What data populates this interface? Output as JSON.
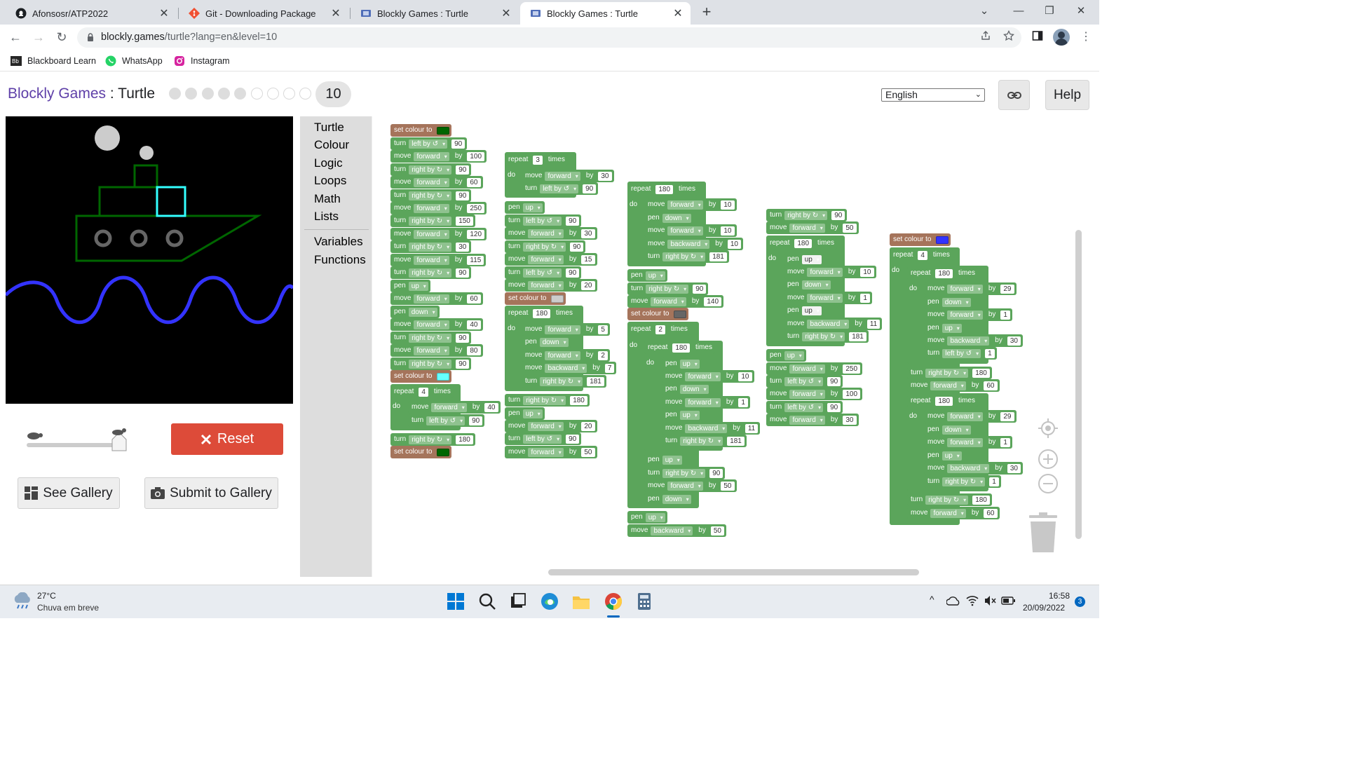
{
  "browser": {
    "tabs": [
      {
        "title": "Afonsosr/ATP2022",
        "icon": "github-icon"
      },
      {
        "title": "Git - Downloading Package",
        "icon": "git-icon"
      },
      {
        "title": "Blockly Games : Turtle",
        "icon": "blockly-icon"
      },
      {
        "title": "Blockly Games : Turtle",
        "icon": "blockly-icon",
        "active": true
      }
    ],
    "url_host": "blockly.games",
    "url_path": "/turtle?lang=en&level=10",
    "bookmarks": [
      {
        "label": "Blackboard Learn",
        "icon": "blackboard-icon"
      },
      {
        "label": "WhatsApp",
        "icon": "whatsapp-icon"
      },
      {
        "label": "Instagram",
        "icon": "instagram-icon"
      }
    ]
  },
  "header": {
    "app_link": "Blockly Games",
    "separator": " : ",
    "app_name": "Turtle",
    "levels_completed": 5,
    "levels_total": 9,
    "current_level": "10",
    "language": "English",
    "help_label": "Help"
  },
  "controls": {
    "reset_label": "Reset",
    "see_gallery_label": "See Gallery",
    "submit_gallery_label": "Submit to Gallery",
    "speed_fraction": 1.0
  },
  "toolbox": {
    "categories": [
      "Turtle",
      "Colour",
      "Logic",
      "Loops",
      "Math",
      "Lists"
    ],
    "categories2": [
      "Variables",
      "Functions"
    ]
  },
  "blocks": {
    "column1": [
      {
        "kind": "colour",
        "label": "set colour to",
        "colour": "#006600"
      },
      {
        "label": "turn",
        "dd": "left by ↺",
        "val": "90"
      },
      {
        "label": "move",
        "dd": "forward",
        "by": "by",
        "val": "100"
      },
      {
        "label": "turn",
        "dd": "right by ↻",
        "val": "90"
      },
      {
        "label": "move",
        "dd": "forward",
        "by": "by",
        "val": "60"
      },
      {
        "label": "turn",
        "dd": "right by ↻",
        "val": "90"
      },
      {
        "label": "move",
        "dd": "forward",
        "by": "by",
        "val": "250"
      },
      {
        "label": "turn",
        "dd": "right by ↻",
        "val": "150"
      },
      {
        "label": "move",
        "dd": "forward",
        "by": "by",
        "val": "120"
      },
      {
        "label": "turn",
        "dd": "right by ↻",
        "val": "30"
      },
      {
        "label": "move",
        "dd": "forward",
        "by": "by",
        "val": "115"
      },
      {
        "label": "turn",
        "dd": "right by ↻",
        "val": "90"
      },
      {
        "label": "pen",
        "dd": "up"
      },
      {
        "label": "move",
        "dd": "forward",
        "by": "by",
        "val": "60"
      },
      {
        "label": "pen",
        "dd": "down"
      },
      {
        "label": "move",
        "dd": "forward",
        "by": "by",
        "val": "40"
      },
      {
        "label": "turn",
        "dd": "right by ↻",
        "val": "90"
      },
      {
        "label": "move",
        "dd": "forward",
        "by": "by",
        "val": "80"
      },
      {
        "label": "turn",
        "dd": "right by ↻",
        "val": "90"
      },
      {
        "kind": "colour",
        "label": "set colour to",
        "colour": "#66ffff"
      },
      {
        "label": "repeat",
        "val": "4",
        "after": "times"
      },
      {
        "label": "move",
        "dd": "forward",
        "by": "by",
        "val": "40"
      },
      {
        "label": "turn",
        "dd": "left by ↺",
        "val": "90"
      },
      {
        "label": "turn",
        "dd": "right by ↻",
        "val": "180"
      },
      {
        "kind": "colour",
        "label": "set colour to",
        "colour": "#006600"
      }
    ],
    "column2": [
      {
        "label": "repeat",
        "val": "3",
        "after": "times"
      },
      {
        "label": "move",
        "dd": "forward",
        "by": "by",
        "val": "30"
      },
      {
        "label": "turn",
        "dd": "left by ↺",
        "val": "90"
      },
      {
        "label": "pen",
        "dd": "up"
      },
      {
        "label": "turn",
        "dd": "left by ↺",
        "val": "90"
      },
      {
        "label": "move",
        "dd": "forward",
        "by": "by",
        "val": "30"
      },
      {
        "label": "turn",
        "dd": "right by ↻",
        "val": "90"
      },
      {
        "label": "move",
        "dd": "forward",
        "by": "by",
        "val": "15"
      },
      {
        "label": "turn",
        "dd": "left by ↺",
        "val": "90"
      },
      {
        "label": "move",
        "dd": "forward",
        "by": "by",
        "val": "20"
      },
      {
        "kind": "colour",
        "label": "set colour to",
        "colour": "#cccccc"
      },
      {
        "label": "repeat",
        "val": "180",
        "after": "times"
      },
      {
        "label": "move",
        "dd": "forward",
        "by": "by",
        "val": "5"
      },
      {
        "label": "pen",
        "dd": "down"
      },
      {
        "label": "move",
        "dd": "forward",
        "by": "by",
        "val": "2"
      },
      {
        "label": "move",
        "dd": "backward",
        "by": "by",
        "val": "7"
      },
      {
        "label": "turn",
        "dd": "right by ↻",
        "val": "181"
      },
      {
        "label": "turn",
        "dd": "right by ↻",
        "val": "180"
      },
      {
        "label": "pen",
        "dd": "up"
      },
      {
        "label": "move",
        "dd": "forward",
        "by": "by",
        "val": "20"
      },
      {
        "label": "turn",
        "dd": "left by ↺",
        "val": "90"
      },
      {
        "label": "move",
        "dd": "forward",
        "by": "by",
        "val": "50"
      }
    ],
    "column3": [
      {
        "label": "repeat",
        "val": "180",
        "after": "times"
      },
      {
        "label": "move",
        "dd": "forward",
        "by": "by",
        "val": "10"
      },
      {
        "label": "pen",
        "dd": "down"
      },
      {
        "label": "move",
        "dd": "forward",
        "by": "by",
        "val": "10"
      },
      {
        "label": "move",
        "dd": "backward",
        "by": "by",
        "val": "10"
      },
      {
        "label": "turn",
        "dd": "right by ↻",
        "val": "181"
      },
      {
        "label": "pen",
        "dd": "up"
      },
      {
        "label": "turn",
        "dd": "right by ↻",
        "val": "90"
      },
      {
        "label": "move",
        "dd": "forward",
        "by": "by",
        "val": "140"
      },
      {
        "kind": "colour",
        "label": "set colour to",
        "colour": "#666666"
      },
      {
        "label": "repeat",
        "val": "2",
        "after": "times"
      },
      {
        "label": "repeat",
        "val": "180",
        "after": "times"
      },
      {
        "label": "pen",
        "dd": "up"
      },
      {
        "label": "move",
        "dd": "forward",
        "by": "by",
        "val": "10"
      },
      {
        "label": "pen",
        "dd": "down"
      },
      {
        "label": "move",
        "dd": "forward",
        "by": "by",
        "val": "1"
      },
      {
        "label": "pen",
        "dd": "up"
      },
      {
        "label": "move",
        "dd": "backward",
        "by": "by",
        "val": "11"
      },
      {
        "label": "turn",
        "dd": "right by ↻",
        "val": "181"
      },
      {
        "label": "pen",
        "dd": "up"
      },
      {
        "label": "turn",
        "dd": "right by ↻",
        "val": "90"
      },
      {
        "label": "move",
        "dd": "forward",
        "by": "by",
        "val": "50"
      },
      {
        "label": "pen",
        "dd": "down"
      },
      {
        "label": "pen",
        "dd": "up"
      },
      {
        "label": "move",
        "dd": "backward",
        "by": "by",
        "val": "50"
      }
    ],
    "column4": [
      {
        "label": "turn",
        "dd": "right by ↻",
        "val": "90"
      },
      {
        "label": "move",
        "dd": "forward",
        "by": "by",
        "val": "50"
      },
      {
        "label": "repeat",
        "val": "180",
        "after": "times"
      },
      {
        "label": "pen",
        "dd": "up"
      },
      {
        "label": "move",
        "dd": "forward",
        "by": "by",
        "val": "10"
      },
      {
        "label": "pen",
        "dd": "down"
      },
      {
        "label": "move",
        "dd": "forward",
        "by": "by",
        "val": "1"
      },
      {
        "label": "pen",
        "dd": "up"
      },
      {
        "label": "move",
        "dd": "backward",
        "by": "by",
        "val": "11"
      },
      {
        "label": "turn",
        "dd": "right by ↻",
        "val": "181"
      },
      {
        "label": "pen",
        "dd": "up"
      },
      {
        "label": "move",
        "dd": "forward",
        "by": "by",
        "val": "250"
      },
      {
        "label": "turn",
        "dd": "left by ↺",
        "val": "90"
      },
      {
        "label": "move",
        "dd": "forward",
        "by": "by",
        "val": "100"
      },
      {
        "label": "turn",
        "dd": "left by ↺",
        "val": "90"
      },
      {
        "label": "move",
        "dd": "forward",
        "by": "by",
        "val": "30"
      }
    ],
    "column5": [
      {
        "kind": "colour",
        "label": "set colour to",
        "colour": "#3333ff"
      },
      {
        "label": "repeat",
        "val": "4",
        "after": "times"
      },
      {
        "label": "repeat",
        "val": "180",
        "after": "times"
      },
      {
        "label": "move",
        "dd": "forward",
        "by": "by",
        "val": "29"
      },
      {
        "label": "pen",
        "dd": "down"
      },
      {
        "label": "move",
        "dd": "forward",
        "by": "by",
        "val": "1"
      },
      {
        "label": "pen",
        "dd": "up"
      },
      {
        "label": "move",
        "dd": "backward",
        "by": "by",
        "val": "30"
      },
      {
        "label": "turn",
        "dd": "left by ↺",
        "val": "1"
      },
      {
        "label": "turn",
        "dd": "right by ↻",
        "val": "180"
      },
      {
        "label": "move",
        "dd": "forward",
        "by": "by",
        "val": "60"
      },
      {
        "label": "repeat",
        "val": "180",
        "after": "times"
      },
      {
        "label": "move",
        "dd": "forward",
        "by": "by",
        "val": "29"
      },
      {
        "label": "pen",
        "dd": "down"
      },
      {
        "label": "move",
        "dd": "forward",
        "by": "by",
        "val": "1"
      },
      {
        "label": "pen",
        "dd": "up"
      },
      {
        "label": "move",
        "dd": "backward",
        "by": "by",
        "val": "30"
      },
      {
        "label": "turn",
        "dd": "right by ↻",
        "val": "1"
      },
      {
        "label": "turn",
        "dd": "right by ↻",
        "val": "180"
      },
      {
        "label": "move",
        "dd": "forward",
        "by": "by",
        "val": "60"
      }
    ],
    "do_label": "do"
  },
  "taskbar": {
    "temperature": "27°C",
    "forecast": "Chuva em breve",
    "time": "16:58",
    "date": "20/09/2022",
    "notifications": "3"
  }
}
